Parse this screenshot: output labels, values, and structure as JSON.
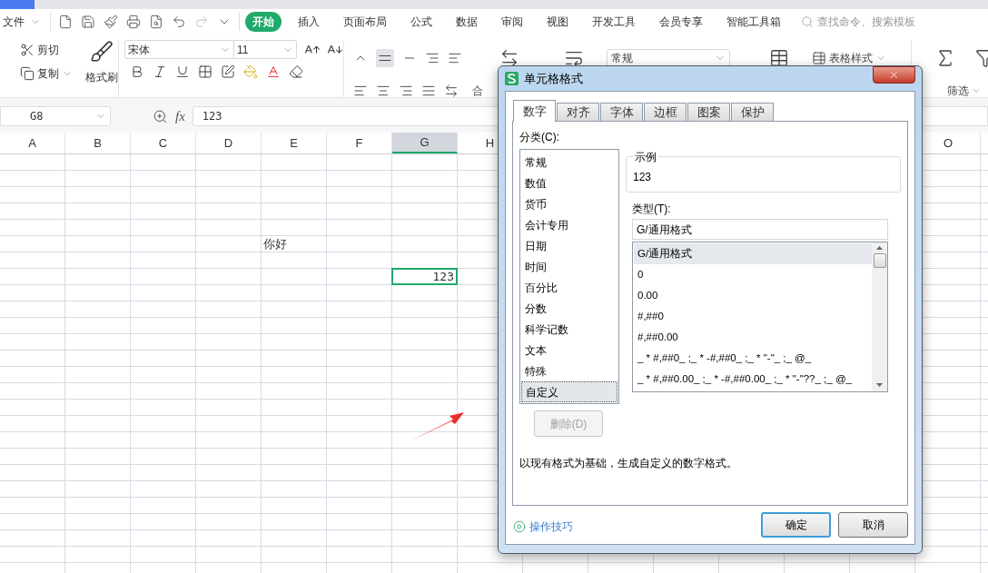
{
  "menu": {
    "file": "文件",
    "tabs": [
      {
        "label": "开始",
        "selected": true
      },
      {
        "label": "插入",
        "selected": false
      },
      {
        "label": "页面布局",
        "selected": false
      },
      {
        "label": "公式",
        "selected": false
      },
      {
        "label": "数据",
        "selected": false
      },
      {
        "label": "审阅",
        "selected": false
      },
      {
        "label": "视图",
        "selected": false
      },
      {
        "label": "开发工具",
        "selected": false
      },
      {
        "label": "会员专享",
        "selected": false
      },
      {
        "label": "智能工具箱",
        "selected": false
      }
    ],
    "search": {
      "placeholder": "查找命令、搜索模板"
    }
  },
  "ribbon": {
    "cut": "剪切",
    "copy": "复制",
    "format_painter": "格式刷",
    "font_name": "宋体",
    "font_size": "11",
    "merge": "合",
    "number_format": "常规",
    "table_style": "表格样式",
    "filter": "筛选"
  },
  "formula_bar": {
    "name_box": "G8",
    "fx_label": "fx",
    "formula": "123"
  },
  "sheet": {
    "columns": {
      "left": [
        {
          "label": "A",
          "selected": false
        },
        {
          "label": "B",
          "selected": false
        },
        {
          "label": "C",
          "selected": false
        },
        {
          "label": "D",
          "selected": false
        },
        {
          "label": "E",
          "selected": false
        },
        {
          "label": "F",
          "selected": false
        },
        {
          "label": "G",
          "selected": true
        },
        {
          "label": "H",
          "selected": false
        }
      ],
      "right": [
        {
          "label": "O",
          "selected": false
        }
      ]
    },
    "cells": [
      {
        "text": "你好",
        "selected": false,
        "kind": "text"
      },
      {
        "text": "123",
        "selected": true,
        "kind": "number"
      }
    ]
  },
  "dialog": {
    "title": "单元格格式",
    "tabs": [
      {
        "label": "数字",
        "selected": true
      },
      {
        "label": "对齐",
        "selected": false
      },
      {
        "label": "字体",
        "selected": false
      },
      {
        "label": "边框",
        "selected": false
      },
      {
        "label": "图案",
        "selected": false
      },
      {
        "label": "保护",
        "selected": false
      }
    ],
    "category_label": "分类(C):",
    "categories": [
      {
        "label": "常规",
        "selected": false
      },
      {
        "label": "数值",
        "selected": false
      },
      {
        "label": "货币",
        "selected": false
      },
      {
        "label": "会计专用",
        "selected": false
      },
      {
        "label": "日期",
        "selected": false
      },
      {
        "label": "时间",
        "selected": false
      },
      {
        "label": "百分比",
        "selected": false
      },
      {
        "label": "分数",
        "selected": false
      },
      {
        "label": "科学记数",
        "selected": false
      },
      {
        "label": "文本",
        "selected": false
      },
      {
        "label": "特殊",
        "selected": false
      },
      {
        "label": "自定义",
        "selected": true
      }
    ],
    "sample": {
      "legend": "示例",
      "value": "123"
    },
    "type_label": "类型(T):",
    "type_value": "G/通用格式",
    "formats": [
      {
        "label": "G/通用格式",
        "selected": true
      },
      {
        "label": "0",
        "selected": false
      },
      {
        "label": "0.00",
        "selected": false
      },
      {
        "label": "#,##0",
        "selected": false
      },
      {
        "label": "#,##0.00",
        "selected": false
      },
      {
        "label": "_ * #,##0_ ;_ * -#,##0_ ;_ * \"-\"_ ;_ @_",
        "selected": false
      },
      {
        "label": "_ * #,##0.00_ ;_ * -#,##0.00_ ;_ * \"-\"??_ ;_ @_",
        "selected": false
      }
    ],
    "delete_button": {
      "label": "删除(D)",
      "disabled": true
    },
    "description": "以现有格式为基础，生成自定义的数字格式。",
    "tips_link": "操作技巧",
    "buttons": [
      {
        "label": "确定",
        "kind": "default"
      },
      {
        "label": "取消",
        "kind": "normal"
      }
    ]
  }
}
